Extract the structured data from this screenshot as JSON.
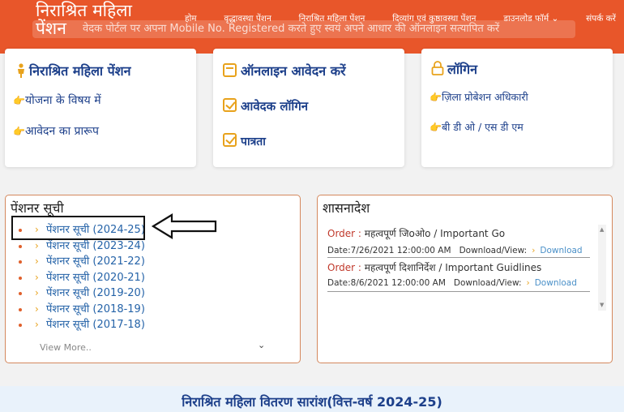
{
  "header": {
    "brand_line1": "निराश्रित महिला",
    "brand_line2": "पेंशन",
    "ticker": "वेदक पोर्टल पर अपना Mobile No. Registered करते हुए स्वयं अपने आधार की ऑनलाइन सत्यापित करें",
    "nav": [
      "होम",
      "वृद्धावस्था पेंशन",
      "निराश्रित महिला पेंशन",
      "दिव्यांग एवं कुष्ठावस्था पेंशन",
      "डाउनलोड फॉर्म",
      "संपर्क करें"
    ],
    "nav_dropdown_glyph": "⌄"
  },
  "cards": {
    "scheme": {
      "title": "निराश्रित महिला पेंशन",
      "links": [
        "योजना के विषय में",
        "आवेदन का प्रारूप"
      ]
    },
    "apply": {
      "title": "ऑनलाइन आवेदन करें",
      "links": [
        "आवेदक लॉगिन",
        "पात्रता"
      ]
    },
    "login": {
      "title": "लॉगिन",
      "links": [
        "ज़िला प्रोबेशन अधिकारी",
        "बी डी ओ / एस डी एम"
      ]
    }
  },
  "pensioner_list": {
    "title": "पेंशनर सूची",
    "items": [
      "पेंशनर सूची (2024-25)",
      "पेंशनर सूची (2023-24)",
      "पेंशनर सूची (2021-22)",
      "पेंशनर सूची (2020-21)",
      "पेंशनर सूची (2019-20)",
      "पेंशनर सूची (2018-19)",
      "पेंशनर सूची (2017-18)"
    ],
    "view_more": "View More.."
  },
  "orders": {
    "title": "शासनादेश",
    "items": [
      {
        "label": "Order :",
        "text": "महत्वपूर्ण जिoओo / Important Go",
        "date_label": "Date:",
        "date": "7/26/2021 12:00:00 AM",
        "dl_label": "Download/View:",
        "dl_link": "Download"
      },
      {
        "label": "Order :",
        "text": "महत्वपूर्ण दिशानिर्देश / Important Guidlines",
        "date_label": "Date:",
        "date": "8/6/2021 12:00:00 AM",
        "dl_label": "Download/View:",
        "dl_link": "Download"
      }
    ]
  },
  "footer": {
    "title": "निराश्रित महिला वितरण सारांश(वित्त-वर्ष 2024-25)"
  },
  "colors": {
    "header_bg": "#e8562a",
    "title_blue": "#1c3f8a",
    "link_blue": "#2563a8",
    "accent": "#e8a21c",
    "order_red": "#c0392b"
  }
}
